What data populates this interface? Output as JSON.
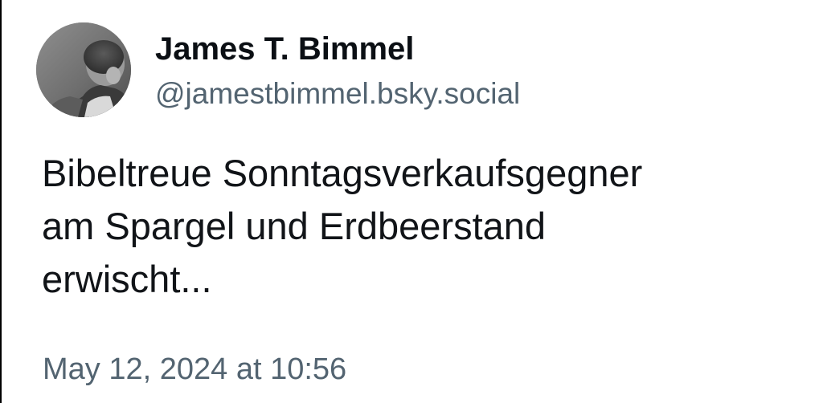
{
  "author": {
    "display_name": "James T. Bimmel",
    "handle": "@jamestbimmel.bsky.social",
    "avatar_icon": "profile-photo"
  },
  "post": {
    "text_lines": [
      "Bibeltreue Sonntagsverkaufsgegner",
      "am Spargel und Erdbeerstand",
      "erwischt..."
    ],
    "timestamp": "May 12, 2024 at 10:56"
  },
  "colors": {
    "name": "#0b0f14",
    "handle": "#536471",
    "body_text": "#111418",
    "timestamp": "#536471",
    "background": "#ffffff"
  }
}
